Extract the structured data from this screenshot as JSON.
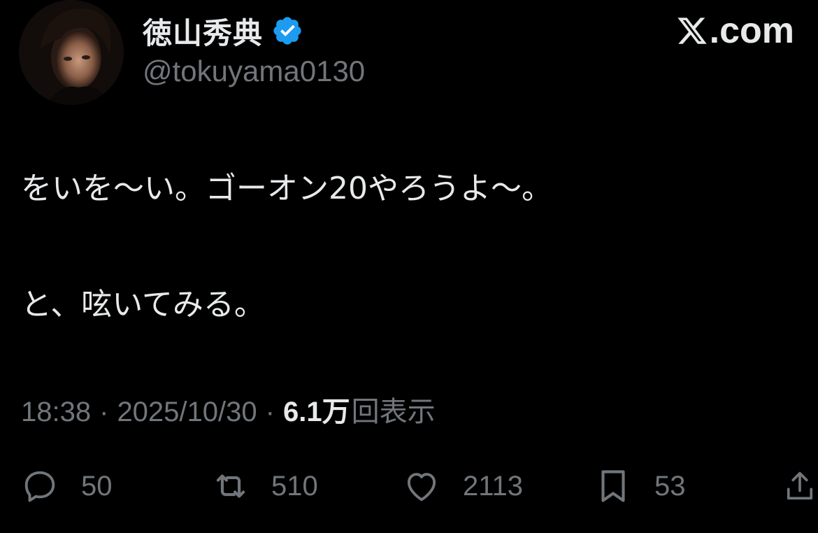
{
  "header": {
    "display_name": "徳山秀典",
    "handle": "@tokuyama0130",
    "verified": true,
    "brand": ".com"
  },
  "tweet": {
    "lines": [
      "をいを〜い。ゴーオン20やろうよ〜。",
      "と、呟いてみる。"
    ]
  },
  "meta": {
    "time": "18:38",
    "separator": "·",
    "date": "2025/10/30",
    "views_count": "6.1",
    "views_unit": "万",
    "views_label": "回表示"
  },
  "actions": {
    "replies": "50",
    "retweets": "510",
    "likes": "2113",
    "bookmarks": "53"
  },
  "colors": {
    "background": "#000000",
    "text": "#e7e9ea",
    "secondary": "#71767b",
    "verified": "#1d9bf0"
  },
  "icons": [
    "verified-badge-icon",
    "x-logo-icon",
    "reply-icon",
    "retweet-icon",
    "like-icon",
    "bookmark-icon",
    "share-icon"
  ]
}
